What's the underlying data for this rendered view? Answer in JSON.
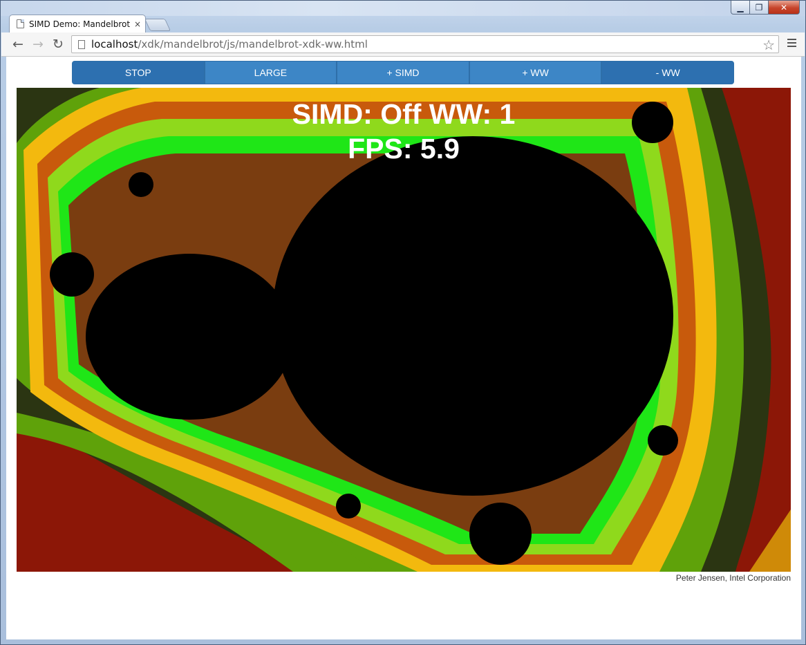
{
  "window": {
    "minimize_icon": "minimize-icon",
    "maximize_icon": "maximize-icon",
    "close_icon": "close-icon"
  },
  "tab": {
    "title": "SIMD Demo: Mandelbrot",
    "close_glyph": "×"
  },
  "address_bar": {
    "host": "localhost",
    "path": "/xdk/mandelbrot/js/mandelbrot-xdk-ww.html"
  },
  "controls": {
    "buttons": [
      {
        "label": "STOP"
      },
      {
        "label": "LARGE"
      },
      {
        "label": "+ SIMD"
      },
      {
        "label": "+ WW"
      },
      {
        "label": "- WW"
      }
    ],
    "colors": {
      "button": "#3d86c6",
      "button_dark": "#2d70b0"
    }
  },
  "overlay": {
    "line1": "SIMD: Off WW: 1",
    "line2": "FPS: 5.9"
  },
  "credit": "Peter Jensen, Intel Corporation",
  "palette": {
    "dark_red": "#8c1707",
    "dark_olive": "#2b3512",
    "green": "#5fa20a",
    "yellow": "#f3b90e",
    "orange": "#c85a0c",
    "lime": "#8fd91c",
    "bright_green": "#1fe617",
    "black": "#000000"
  }
}
